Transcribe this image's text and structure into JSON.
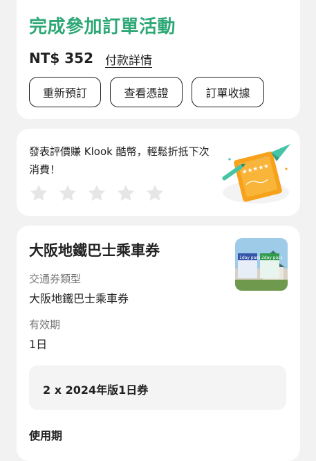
{
  "status": {
    "title": "完成參加訂單活動",
    "price": "NT$ 352",
    "payment_link": "付款詳情",
    "buttons": [
      "重新預訂",
      "查看憑證",
      "訂單收據"
    ]
  },
  "review": {
    "prompt": "發表評價賺 Klook 酷幣，輕鬆折抵下次消費！",
    "rating": 0,
    "max_rating": 5
  },
  "product": {
    "title": "大阪地鐵巴士乘車券",
    "fields": [
      {
        "label": "交通券類型",
        "value": "大阪地鐵巴士乘車券"
      },
      {
        "label": "有效期",
        "value": "1日"
      }
    ],
    "quantity_line": "2 x 2024年版1日券",
    "next_section": "使用期",
    "thumbnail": {
      "pass1_text": "1day pass",
      "pass2_text": "2day pass"
    }
  },
  "colors": {
    "accent_green": "#2ea876",
    "star_grey": "#e6e6e6",
    "illustration_orange": "#f7a21a",
    "illustration_teal": "#46c4a6"
  }
}
